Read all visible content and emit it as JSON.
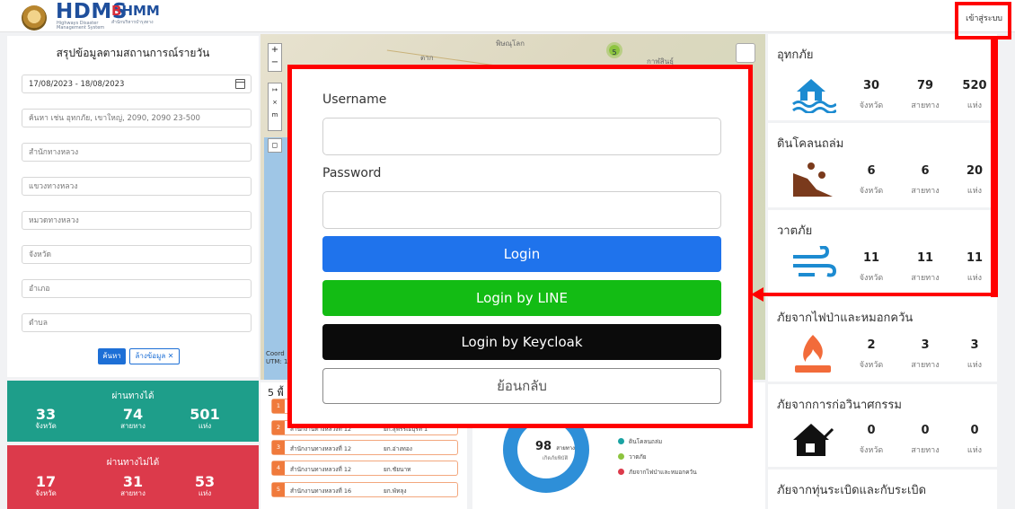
{
  "header": {
    "logo_hdms": "HDMS",
    "logo_hdms_sub": "Highways Disaster Management System",
    "logo_bhmm_b": "B",
    "logo_bhmm_rest": "HMM",
    "logo_bhmm_sub": "สำนักบริหารบำรุงทาง",
    "login_link": "เข้าสู่ระบบ"
  },
  "filter": {
    "title": "สรุปข้อมูลตามสถานการณ์รายวัน",
    "date_range": "17/08/2023 - 18/08/2023",
    "search_placeholder": "ค้นหา เช่น อุทกภัย, เขาใหญ่, 2090, 2090 23-500",
    "bureau_placeholder": "สำนักทางหลวง",
    "district_placeholder": "แขวงทางหลวง",
    "unit_placeholder": "หมวดทางหลวง",
    "province_placeholder": "จังหวัด",
    "amphoe_placeholder": "อำเภอ",
    "tambon_placeholder": "ตำบล",
    "search_button": "ค้นหา",
    "clear_button": "ล้างข้อมูล ✕"
  },
  "passable": {
    "title": "ผ่านทางได้",
    "provinces": "33",
    "provinces_unit": "จังหวัด",
    "routes": "74",
    "routes_unit": "สายทาง",
    "places": "501",
    "places_unit": "แห่ง"
  },
  "impassable": {
    "title": "ผ่านทางไม่ได้",
    "provinces": "17",
    "provinces_unit": "จังหวัด",
    "routes": "31",
    "routes_unit": "สายทาง",
    "places": "53",
    "places_unit": "แห่ง"
  },
  "map": {
    "zoom_in": "+",
    "zoom_out": "−",
    "cluster_count": "5",
    "label_phitsanulok": "พิษณุโลก",
    "label_tak": "ตาก",
    "label_kamphaeng": "กาฬสินธุ์",
    "coord_text": "Coord",
    "utm_text": "UTM: 1"
  },
  "list": {
    "title": "5 พื้",
    "items": [
      {
        "num": "1",
        "office": "",
        "area": ""
      },
      {
        "num": "2",
        "office": "สำนักงานทางหลวงที่ 12",
        "area": "ยก.สุพรรณบุรีที่ 1"
      },
      {
        "num": "3",
        "office": "สำนักงานทางหลวงที่ 12",
        "area": "ยก.อ่างทอง"
      },
      {
        "num": "4",
        "office": "สำนักงานทางหลวงที่ 12",
        "area": "ยก.ชัยนาท"
      },
      {
        "num": "5",
        "office": "สำนักงานทางหลวงที่ 16",
        "area": "ยก.พัทลุง"
      }
    ]
  },
  "donut": {
    "center_value": "98",
    "center_unit": "สายทาง",
    "center_sub": "เกิดภัยพิบัติ",
    "legend": [
      {
        "label": "ดินโคลนถล่ม",
        "color": "#1aa3a3"
      },
      {
        "label": "วาตภัย",
        "color": "#8dc43f"
      },
      {
        "label": "ภัยจากไฟป่าและหมอกควัน",
        "color": "#dc3a4b"
      }
    ],
    "colors": {
      "main": "#2e8fd8",
      "accent": "#1aa3a3"
    }
  },
  "hazards": [
    {
      "name": "อุทกภัย",
      "icon": "flood-icon",
      "provinces": "30",
      "routes": "79",
      "places": "520"
    },
    {
      "name": "ดินโคลนถล่ม",
      "icon": "landslide-icon",
      "provinces": "6",
      "routes": "6",
      "places": "20"
    },
    {
      "name": "วาตภัย",
      "icon": "wind-icon",
      "provinces": "11",
      "routes": "11",
      "places": "11"
    },
    {
      "name": "ภัยจากไฟป่าและหมอกควัน",
      "icon": "fire-icon",
      "provinces": "2",
      "routes": "3",
      "places": "3"
    },
    {
      "name": "ภัยจากการก่อวินาศกรรม",
      "icon": "sabotage-icon",
      "provinces": "0",
      "routes": "0",
      "places": "0"
    },
    {
      "name": "ภัยจากทุ่นระเบิดและกับระเบิด",
      "icon": "mine-icon",
      "provinces": "",
      "routes": "",
      "places": ""
    }
  ],
  "units": {
    "provinces": "จังหวัด",
    "routes": "สายทาง",
    "places": "แห่ง"
  },
  "modal": {
    "username_label": "Username",
    "password_label": "Password",
    "login_button": "Login",
    "line_button": "Login by LINE",
    "keycloak_button": "Login by Keycloak",
    "back_button": "ย้อนกลับ"
  },
  "colors": {
    "primary_blue": "#1f73ec",
    "line_green": "#13bc14",
    "keycloak_black": "#0b0b0b",
    "annotation_red": "#ff0000",
    "pass_teal": "#1e9e8a",
    "nopass_red": "#dc3a4b"
  }
}
